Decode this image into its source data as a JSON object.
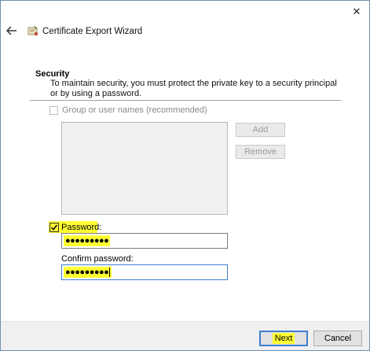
{
  "window": {
    "title": "Certificate Export Wizard",
    "close_glyph": "✕",
    "back_glyph": "←"
  },
  "page": {
    "section_title": "Security",
    "description": "To maintain security, you must protect the private key to a security principal or by using a password."
  },
  "group_option": {
    "label": "Group or user names (recommended)",
    "checked": false,
    "enabled": false
  },
  "buttons": {
    "add": "Add",
    "remove": "Remove",
    "next": "Next",
    "cancel": "Cancel"
  },
  "password": {
    "checkbox_label": "Password:",
    "checked": true,
    "value_masked": "●●●●●●●●●"
  },
  "confirm": {
    "label": "Confirm password:",
    "value_masked": "●●●●●●●●●"
  },
  "colors": {
    "highlight": "#ffff33",
    "focus": "#3c7fd0"
  }
}
